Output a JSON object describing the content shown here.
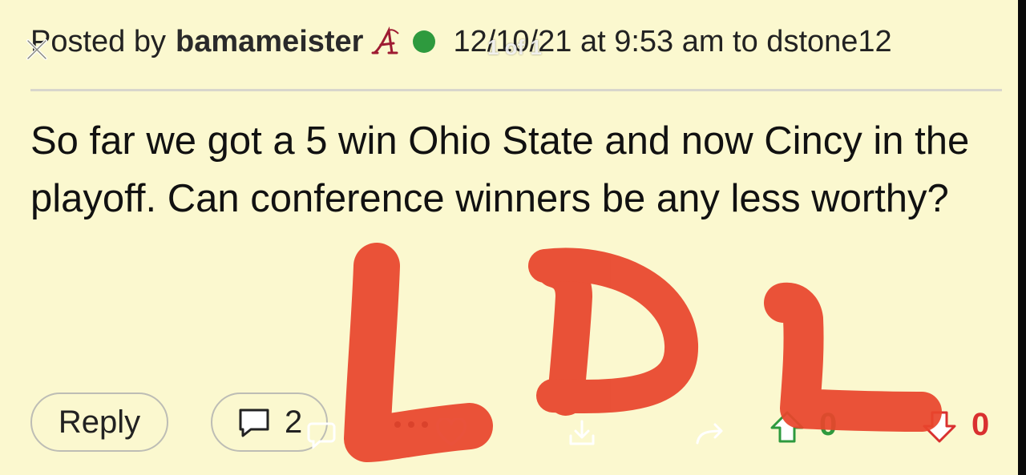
{
  "post": {
    "posted_by_prefix": "Posted by",
    "author": "bamameister",
    "date_line": "12/10/21 at 9:53 am to dstone12",
    "page_indicator": "1 of 1",
    "body": "So far we got a 5 win Ohio State and now Cincy in the playoff. Can conference winners be any less worthy?"
  },
  "actions": {
    "reply_label": "Reply",
    "comment_count": "2",
    "upvotes": "0",
    "downvotes": "0"
  },
  "overlay": {
    "handwritten_text": "LOL"
  },
  "colors": {
    "background": "#fbf8cf",
    "online": "#2e9a3e",
    "team": "#9e1b32",
    "upvote": "#2e9a3e",
    "downvote": "#d93030",
    "scribble": "#e8452c"
  },
  "icons": [
    "close-icon",
    "team-logo-icon",
    "online-status-icon",
    "comment-icon",
    "more-icon",
    "heart-icon",
    "download-icon",
    "share-icon",
    "upvote-icon",
    "downvote-icon"
  ]
}
